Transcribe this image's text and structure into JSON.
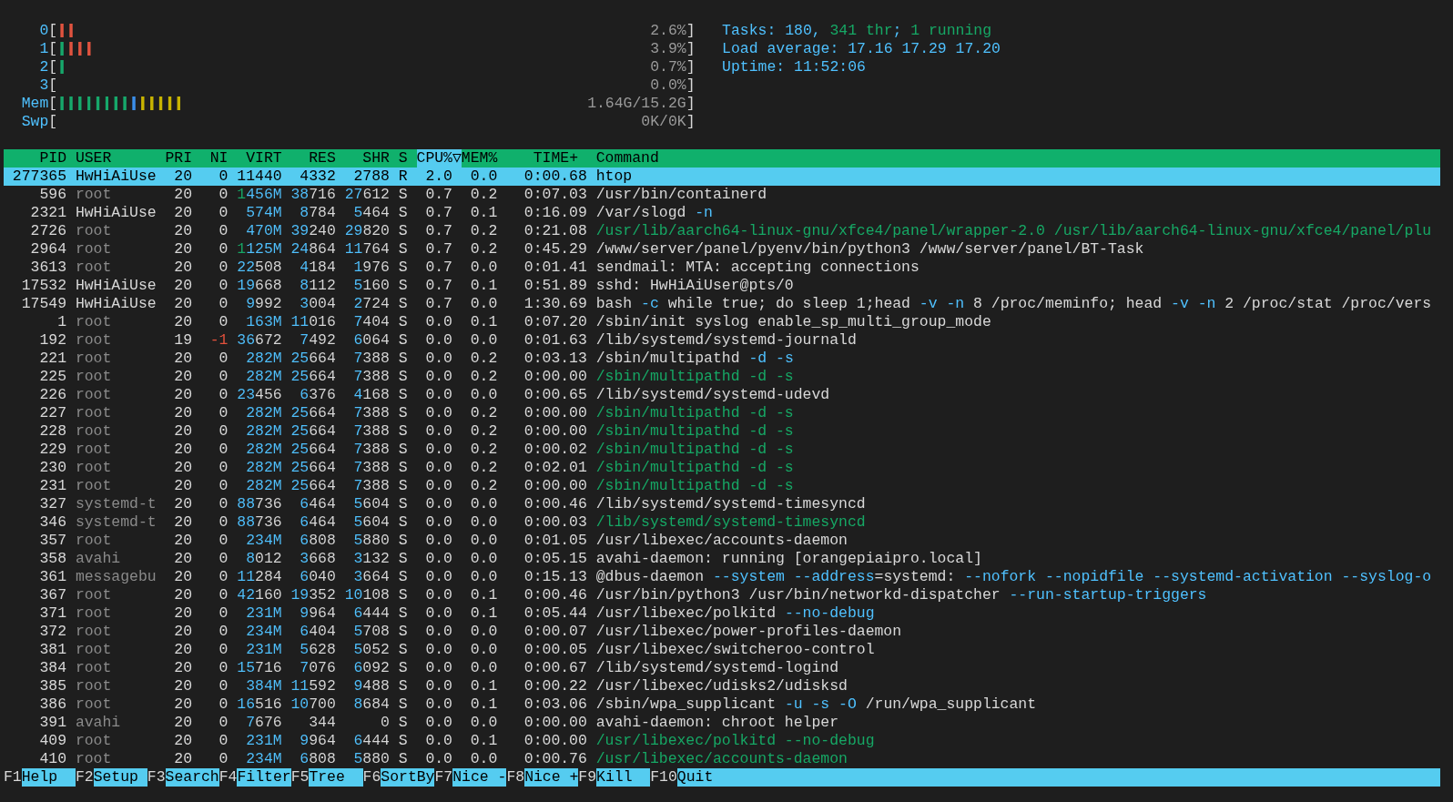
{
  "meters": {
    "brackets": [
      "[",
      "]"
    ],
    "items": [
      {
        "label": "0",
        "segments": [
          {
            "text": "||",
            "color": "#e0533f"
          }
        ],
        "value": "2.6%"
      },
      {
        "label": "1",
        "segments": [
          {
            "text": "|",
            "color": "#17a86b"
          },
          {
            "text": "|||",
            "color": "#e0533f"
          }
        ],
        "value": "3.9%"
      },
      {
        "label": "2",
        "segments": [
          {
            "text": "|",
            "color": "#17a86b"
          }
        ],
        "value": "0.7%"
      },
      {
        "label": "3",
        "value": "0.0%"
      },
      {
        "label": "Mem",
        "segments": [
          {
            "text": "||||||||",
            "color": "#17a86b"
          },
          {
            "text": "|",
            "color": "#3b8eea"
          },
          {
            "text": "|||||",
            "color": "#c8b400"
          }
        ],
        "value": "1.64G/15.2G"
      },
      {
        "label": "Swp",
        "value": "0K/0K"
      }
    ]
  },
  "summary": [
    {
      "parts": [
        {
          "text": "Tasks: 180, ",
          "kind": "label"
        },
        {
          "text": "341 thr",
          "kind": "thread"
        },
        {
          "text": "; ",
          "kind": "label"
        },
        {
          "text": "1 running",
          "kind": "running"
        }
      ]
    },
    {
      "parts": [
        {
          "text": "Load average: ",
          "kind": "label"
        },
        {
          "text": "17.16 17.29 17.20",
          "kind": "value"
        }
      ]
    },
    {
      "parts": [
        {
          "text": "Uptime: ",
          "kind": "label"
        },
        {
          "text": "11:52:06",
          "kind": "value"
        }
      ]
    }
  ],
  "table": {
    "columns": [
      {
        "label": "PID",
        "sorted": false
      },
      {
        "label": "USER",
        "sorted": false
      },
      {
        "label": "PRI",
        "sorted": false
      },
      {
        "label": "NI",
        "sorted": false
      },
      {
        "label": "VIRT",
        "sorted": false
      },
      {
        "label": "RES",
        "sorted": false
      },
      {
        "label": "SHR",
        "sorted": false
      },
      {
        "label": "S",
        "sorted": false
      },
      {
        "label": "CPU%▽",
        "sorted": true
      },
      {
        "label": "MEM%",
        "sorted": false
      },
      {
        "label": "TIME+",
        "sorted": false
      },
      {
        "label": "Command",
        "sorted": false
      }
    ],
    "rows": [
      {
        "pid": "277365",
        "user": "HwHiAiUse",
        "own_user": true,
        "pri": "20",
        "ni": "0",
        "virt": "11440",
        "res": "4332",
        "shr": "2788",
        "state": "R",
        "cpu": "2.0",
        "mem": "0.0",
        "time": "0:00.68",
        "command": [
          {
            "text": "htop",
            "kind": "plain"
          }
        ],
        "thread": false,
        "selected": true
      },
      {
        "pid": "596",
        "user": "root",
        "own_user": false,
        "pri": "20",
        "ni": "0",
        "virt": "1456M",
        "res": "38716",
        "shr": "27612",
        "state": "S",
        "cpu": "0.7",
        "mem": "0.2",
        "time": "0:07.03",
        "command": [
          {
            "text": "/usr/bin/containerd",
            "kind": "plain"
          }
        ],
        "thread": false,
        "selected": false
      },
      {
        "pid": "2321",
        "user": "HwHiAiUse",
        "own_user": true,
        "pri": "20",
        "ni": "0",
        "virt": "574M",
        "res": "8784",
        "shr": "5464",
        "state": "S",
        "cpu": "0.7",
        "mem": "0.1",
        "time": "0:16.09",
        "command": [
          {
            "text": "/var/slogd ",
            "kind": "plain"
          },
          {
            "text": "-n",
            "kind": "option"
          }
        ],
        "thread": false,
        "selected": false
      },
      {
        "pid": "2726",
        "user": "root",
        "own_user": false,
        "pri": "20",
        "ni": "0",
        "virt": "470M",
        "res": "39240",
        "shr": "29820",
        "state": "S",
        "cpu": "0.7",
        "mem": "0.2",
        "time": "0:21.08",
        "command": [
          {
            "text": "/usr/lib/aarch64-linux-gnu/xfce4/panel/wrapper-2.0 /usr/lib/aarch64-linux-gnu/xfce4/panel/plu",
            "kind": "plain"
          }
        ],
        "thread": true,
        "selected": false
      },
      {
        "pid": "2964",
        "user": "root",
        "own_user": false,
        "pri": "20",
        "ni": "0",
        "virt": "1125M",
        "res": "24864",
        "shr": "11764",
        "state": "S",
        "cpu": "0.7",
        "mem": "0.2",
        "time": "0:45.29",
        "command": [
          {
            "text": "/www/server/panel/pyenv/bin/python3 /www/server/panel/BT-Task",
            "kind": "plain"
          }
        ],
        "thread": false,
        "selected": false
      },
      {
        "pid": "3613",
        "user": "root",
        "own_user": false,
        "pri": "20",
        "ni": "0",
        "virt": "22508",
        "res": "4184",
        "shr": "1976",
        "state": "S",
        "cpu": "0.7",
        "mem": "0.0",
        "time": "0:01.41",
        "command": [
          {
            "text": "sendmail: MTA: accepting connections",
            "kind": "plain"
          }
        ],
        "thread": false,
        "selected": false
      },
      {
        "pid": "17532",
        "user": "HwHiAiUse",
        "own_user": true,
        "pri": "20",
        "ni": "0",
        "virt": "19668",
        "res": "8112",
        "shr": "5160",
        "state": "S",
        "cpu": "0.7",
        "mem": "0.1",
        "time": "0:51.89",
        "command": [
          {
            "text": "sshd: HwHiAiUser@pts/0",
            "kind": "plain"
          }
        ],
        "thread": false,
        "selected": false
      },
      {
        "pid": "17549",
        "user": "HwHiAiUse",
        "own_user": true,
        "pri": "20",
        "ni": "0",
        "virt": "9992",
        "res": "3004",
        "shr": "2724",
        "state": "S",
        "cpu": "0.7",
        "mem": "0.0",
        "time": "1:30.69",
        "command": [
          {
            "text": "bash ",
            "kind": "plain"
          },
          {
            "text": "-c",
            "kind": "option"
          },
          {
            "text": " while true; do sleep 1;head ",
            "kind": "plain"
          },
          {
            "text": "-v -n",
            "kind": "option"
          },
          {
            "text": " 8 /proc/meminfo; head ",
            "kind": "plain"
          },
          {
            "text": "-v -n",
            "kind": "option"
          },
          {
            "text": " 2 /proc/stat /proc/vers",
            "kind": "plain"
          }
        ],
        "thread": false,
        "selected": false
      },
      {
        "pid": "1",
        "user": "root",
        "own_user": false,
        "pri": "20",
        "ni": "0",
        "virt": "163M",
        "res": "11016",
        "shr": "7404",
        "state": "S",
        "cpu": "0.0",
        "mem": "0.1",
        "time": "0:07.20",
        "command": [
          {
            "text": "/sbin/init syslog enable_sp_multi_group_mode",
            "kind": "plain"
          }
        ],
        "thread": false,
        "selected": false
      },
      {
        "pid": "192",
        "user": "root",
        "own_user": false,
        "pri": "19",
        "ni": "-1",
        "virt": "36672",
        "res": "7492",
        "shr": "6064",
        "state": "S",
        "cpu": "0.0",
        "mem": "0.0",
        "time": "0:01.63",
        "command": [
          {
            "text": "/lib/systemd/systemd-journald",
            "kind": "plain"
          }
        ],
        "thread": false,
        "selected": false
      },
      {
        "pid": "221",
        "user": "root",
        "own_user": false,
        "pri": "20",
        "ni": "0",
        "virt": "282M",
        "res": "25664",
        "shr": "7388",
        "state": "S",
        "cpu": "0.0",
        "mem": "0.2",
        "time": "0:03.13",
        "command": [
          {
            "text": "/sbin/multipathd ",
            "kind": "plain"
          },
          {
            "text": "-d -s",
            "kind": "option"
          }
        ],
        "thread": false,
        "selected": false
      },
      {
        "pid": "225",
        "user": "root",
        "own_user": false,
        "pri": "20",
        "ni": "0",
        "virt": "282M",
        "res": "25664",
        "shr": "7388",
        "state": "S",
        "cpu": "0.0",
        "mem": "0.2",
        "time": "0:00.00",
        "command": [
          {
            "text": "/sbin/multipathd -d -s",
            "kind": "plain"
          }
        ],
        "thread": true,
        "selected": false
      },
      {
        "pid": "226",
        "user": "root",
        "own_user": false,
        "pri": "20",
        "ni": "0",
        "virt": "23456",
        "res": "6376",
        "shr": "4168",
        "state": "S",
        "cpu": "0.0",
        "mem": "0.0",
        "time": "0:00.65",
        "command": [
          {
            "text": "/lib/systemd/systemd-udevd",
            "kind": "plain"
          }
        ],
        "thread": false,
        "selected": false
      },
      {
        "pid": "227",
        "user": "root",
        "own_user": false,
        "pri": "20",
        "ni": "0",
        "virt": "282M",
        "res": "25664",
        "shr": "7388",
        "state": "S",
        "cpu": "0.0",
        "mem": "0.2",
        "time": "0:00.00",
        "command": [
          {
            "text": "/sbin/multipathd -d -s",
            "kind": "plain"
          }
        ],
        "thread": true,
        "selected": false
      },
      {
        "pid": "228",
        "user": "root",
        "own_user": false,
        "pri": "20",
        "ni": "0",
        "virt": "282M",
        "res": "25664",
        "shr": "7388",
        "state": "S",
        "cpu": "0.0",
        "mem": "0.2",
        "time": "0:00.00",
        "command": [
          {
            "text": "/sbin/multipathd -d -s",
            "kind": "plain"
          }
        ],
        "thread": true,
        "selected": false
      },
      {
        "pid": "229",
        "user": "root",
        "own_user": false,
        "pri": "20",
        "ni": "0",
        "virt": "282M",
        "res": "25664",
        "shr": "7388",
        "state": "S",
        "cpu": "0.0",
        "mem": "0.2",
        "time": "0:00.02",
        "command": [
          {
            "text": "/sbin/multipathd -d -s",
            "kind": "plain"
          }
        ],
        "thread": true,
        "selected": false
      },
      {
        "pid": "230",
        "user": "root",
        "own_user": false,
        "pri": "20",
        "ni": "0",
        "virt": "282M",
        "res": "25664",
        "shr": "7388",
        "state": "S",
        "cpu": "0.0",
        "mem": "0.2",
        "time": "0:02.01",
        "command": [
          {
            "text": "/sbin/multipathd -d -s",
            "kind": "plain"
          }
        ],
        "thread": true,
        "selected": false
      },
      {
        "pid": "231",
        "user": "root",
        "own_user": false,
        "pri": "20",
        "ni": "0",
        "virt": "282M",
        "res": "25664",
        "shr": "7388",
        "state": "S",
        "cpu": "0.0",
        "mem": "0.2",
        "time": "0:00.00",
        "command": [
          {
            "text": "/sbin/multipathd -d -s",
            "kind": "plain"
          }
        ],
        "thread": true,
        "selected": false
      },
      {
        "pid": "327",
        "user": "systemd-t",
        "own_user": false,
        "pri": "20",
        "ni": "0",
        "virt": "88736",
        "res": "6464",
        "shr": "5604",
        "state": "S",
        "cpu": "0.0",
        "mem": "0.0",
        "time": "0:00.46",
        "command": [
          {
            "text": "/lib/systemd/systemd-timesyncd",
            "kind": "plain"
          }
        ],
        "thread": false,
        "selected": false
      },
      {
        "pid": "346",
        "user": "systemd-t",
        "own_user": false,
        "pri": "20",
        "ni": "0",
        "virt": "88736",
        "res": "6464",
        "shr": "5604",
        "state": "S",
        "cpu": "0.0",
        "mem": "0.0",
        "time": "0:00.03",
        "command": [
          {
            "text": "/lib/systemd/systemd-timesyncd",
            "kind": "plain"
          }
        ],
        "thread": true,
        "selected": false
      },
      {
        "pid": "357",
        "user": "root",
        "own_user": false,
        "pri": "20",
        "ni": "0",
        "virt": "234M",
        "res": "6808",
        "shr": "5880",
        "state": "S",
        "cpu": "0.0",
        "mem": "0.0",
        "time": "0:01.05",
        "command": [
          {
            "text": "/usr/libexec/accounts-daemon",
            "kind": "plain"
          }
        ],
        "thread": false,
        "selected": false
      },
      {
        "pid": "358",
        "user": "avahi",
        "own_user": false,
        "pri": "20",
        "ni": "0",
        "virt": "8012",
        "res": "3668",
        "shr": "3132",
        "state": "S",
        "cpu": "0.0",
        "mem": "0.0",
        "time": "0:05.15",
        "command": [
          {
            "text": "avahi-daemon: running [orangepiaipro.local]",
            "kind": "plain"
          }
        ],
        "thread": false,
        "selected": false
      },
      {
        "pid": "361",
        "user": "messagebu",
        "own_user": false,
        "pri": "20",
        "ni": "0",
        "virt": "11284",
        "res": "6040",
        "shr": "3664",
        "state": "S",
        "cpu": "0.0",
        "mem": "0.0",
        "time": "0:15.13",
        "command": [
          {
            "text": "@dbus-daemon ",
            "kind": "plain"
          },
          {
            "text": "--system --address",
            "kind": "option"
          },
          {
            "text": "=systemd: ",
            "kind": "plain"
          },
          {
            "text": "--nofork --nopidfile --systemd-activation --syslog-o",
            "kind": "option"
          }
        ],
        "thread": false,
        "selected": false
      },
      {
        "pid": "367",
        "user": "root",
        "own_user": false,
        "pri": "20",
        "ni": "0",
        "virt": "42160",
        "res": "19352",
        "shr": "10108",
        "state": "S",
        "cpu": "0.0",
        "mem": "0.1",
        "time": "0:00.46",
        "command": [
          {
            "text": "/usr/bin/python3 /usr/bin/networkd-dispatcher ",
            "kind": "plain"
          },
          {
            "text": "--run-startup-triggers",
            "kind": "option"
          }
        ],
        "thread": false,
        "selected": false
      },
      {
        "pid": "371",
        "user": "root",
        "own_user": false,
        "pri": "20",
        "ni": "0",
        "virt": "231M",
        "res": "9964",
        "shr": "6444",
        "state": "S",
        "cpu": "0.0",
        "mem": "0.1",
        "time": "0:05.44",
        "command": [
          {
            "text": "/usr/libexec/polkitd ",
            "kind": "plain"
          },
          {
            "text": "--no-debug",
            "kind": "option"
          }
        ],
        "thread": false,
        "selected": false
      },
      {
        "pid": "372",
        "user": "root",
        "own_user": false,
        "pri": "20",
        "ni": "0",
        "virt": "234M",
        "res": "6404",
        "shr": "5708",
        "state": "S",
        "cpu": "0.0",
        "mem": "0.0",
        "time": "0:00.07",
        "command": [
          {
            "text": "/usr/libexec/power-profiles-daemon",
            "kind": "plain"
          }
        ],
        "thread": false,
        "selected": false
      },
      {
        "pid": "381",
        "user": "root",
        "own_user": false,
        "pri": "20",
        "ni": "0",
        "virt": "231M",
        "res": "5628",
        "shr": "5052",
        "state": "S",
        "cpu": "0.0",
        "mem": "0.0",
        "time": "0:00.05",
        "command": [
          {
            "text": "/usr/libexec/switcheroo-control",
            "kind": "plain"
          }
        ],
        "thread": false,
        "selected": false
      },
      {
        "pid": "384",
        "user": "root",
        "own_user": false,
        "pri": "20",
        "ni": "0",
        "virt": "15716",
        "res": "7076",
        "shr": "6092",
        "state": "S",
        "cpu": "0.0",
        "mem": "0.0",
        "time": "0:00.67",
        "command": [
          {
            "text": "/lib/systemd/systemd-logind",
            "kind": "plain"
          }
        ],
        "thread": false,
        "selected": false
      },
      {
        "pid": "385",
        "user": "root",
        "own_user": false,
        "pri": "20",
        "ni": "0",
        "virt": "384M",
        "res": "11592",
        "shr": "9488",
        "state": "S",
        "cpu": "0.0",
        "mem": "0.1",
        "time": "0:00.22",
        "command": [
          {
            "text": "/usr/libexec/udisks2/udisksd",
            "kind": "plain"
          }
        ],
        "thread": false,
        "selected": false
      },
      {
        "pid": "386",
        "user": "root",
        "own_user": false,
        "pri": "20",
        "ni": "0",
        "virt": "16516",
        "res": "10700",
        "shr": "8684",
        "state": "S",
        "cpu": "0.0",
        "mem": "0.1",
        "time": "0:03.06",
        "command": [
          {
            "text": "/sbin/wpa_supplicant ",
            "kind": "plain"
          },
          {
            "text": "-u -s -O",
            "kind": "option"
          },
          {
            "text": " /run/wpa_supplicant",
            "kind": "plain"
          }
        ],
        "thread": false,
        "selected": false
      },
      {
        "pid": "391",
        "user": "avahi",
        "own_user": false,
        "pri": "20",
        "ni": "0",
        "virt": "7676",
        "res": "344",
        "shr": "0",
        "state": "S",
        "cpu": "0.0",
        "mem": "0.0",
        "time": "0:00.00",
        "command": [
          {
            "text": "avahi-daemon: chroot helper",
            "kind": "plain"
          }
        ],
        "thread": false,
        "selected": false
      },
      {
        "pid": "409",
        "user": "root",
        "own_user": false,
        "pri": "20",
        "ni": "0",
        "virt": "231M",
        "res": "9964",
        "shr": "6444",
        "state": "S",
        "cpu": "0.0",
        "mem": "0.1",
        "time": "0:00.00",
        "command": [
          {
            "text": "/usr/libexec/polkitd --no-debug",
            "kind": "plain"
          }
        ],
        "thread": true,
        "selected": false
      },
      {
        "pid": "410",
        "user": "root",
        "own_user": false,
        "pri": "20",
        "ni": "0",
        "virt": "234M",
        "res": "6808",
        "shr": "5880",
        "state": "S",
        "cpu": "0.0",
        "mem": "0.0",
        "time": "0:00.76",
        "command": [
          {
            "text": "/usr/libexec/accounts-daemon",
            "kind": "plain"
          }
        ],
        "thread": true,
        "selected": false
      }
    ]
  },
  "function_keys": [
    {
      "key": "F1",
      "label": "Help"
    },
    {
      "key": "F2",
      "label": "Setup"
    },
    {
      "key": "F3",
      "label": "Search"
    },
    {
      "key": "F4",
      "label": "Filter"
    },
    {
      "key": "F5",
      "label": "Tree"
    },
    {
      "key": "F6",
      "label": "SortBy"
    },
    {
      "key": "F7",
      "label": "Nice -"
    },
    {
      "key": "F8",
      "label": "Nice +"
    },
    {
      "key": "F9",
      "label": "Kill"
    },
    {
      "key": "F10",
      "label": "Quit"
    }
  ]
}
